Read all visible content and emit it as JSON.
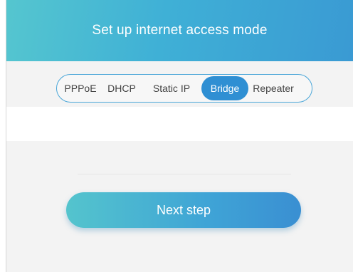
{
  "header": {
    "title": "Set up internet access mode"
  },
  "modes": {
    "options": [
      "PPPoE",
      "DHCP",
      "Static IP",
      "Bridge",
      "Repeater"
    ],
    "selected": "Bridge"
  },
  "actions": {
    "next_label": "Next step"
  },
  "colors": {
    "accent": "#2f8fd3",
    "header_gradient_start": "#55c6cf",
    "header_gradient_end": "#3a9ad3"
  }
}
